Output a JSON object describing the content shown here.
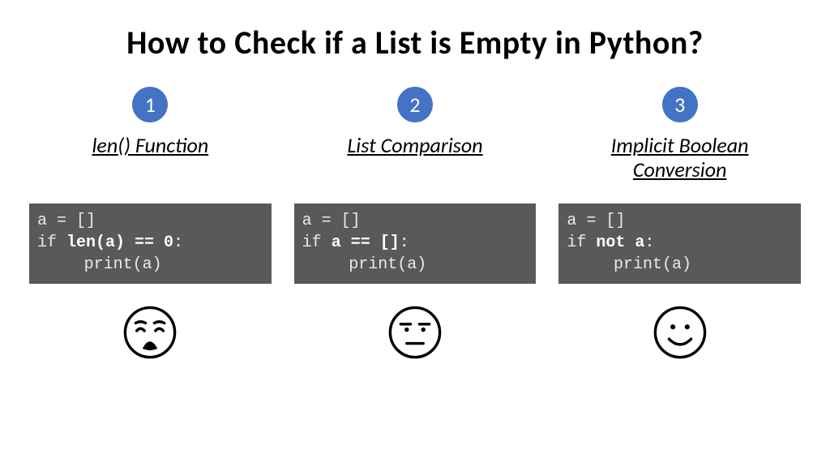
{
  "title": "How to Check if a List is Empty in Python?",
  "columns": [
    {
      "badge": "1",
      "subtitle": "len() Function",
      "code": {
        "line1": "a = []",
        "line2_pre": "if ",
        "line2_bold": "len(a) == 0",
        "line2_post": ":",
        "line3": "print(a)"
      },
      "face": "weary"
    },
    {
      "badge": "2",
      "subtitle": "List Comparison",
      "code": {
        "line1": "a = []",
        "line2_pre": "if ",
        "line2_bold": "a == []",
        "line2_post": ":",
        "line3": "print(a)"
      },
      "face": "unamused"
    },
    {
      "badge": "3",
      "subtitle": "Implicit Boolean Conversion",
      "code": {
        "line1": "a = []",
        "line2_pre": "if ",
        "line2_bold": "not a",
        "line2_post": ":",
        "line3": "print(a)"
      },
      "face": "smile"
    }
  ],
  "colors": {
    "accent": "#4472C4",
    "code_bg": "#595959"
  }
}
